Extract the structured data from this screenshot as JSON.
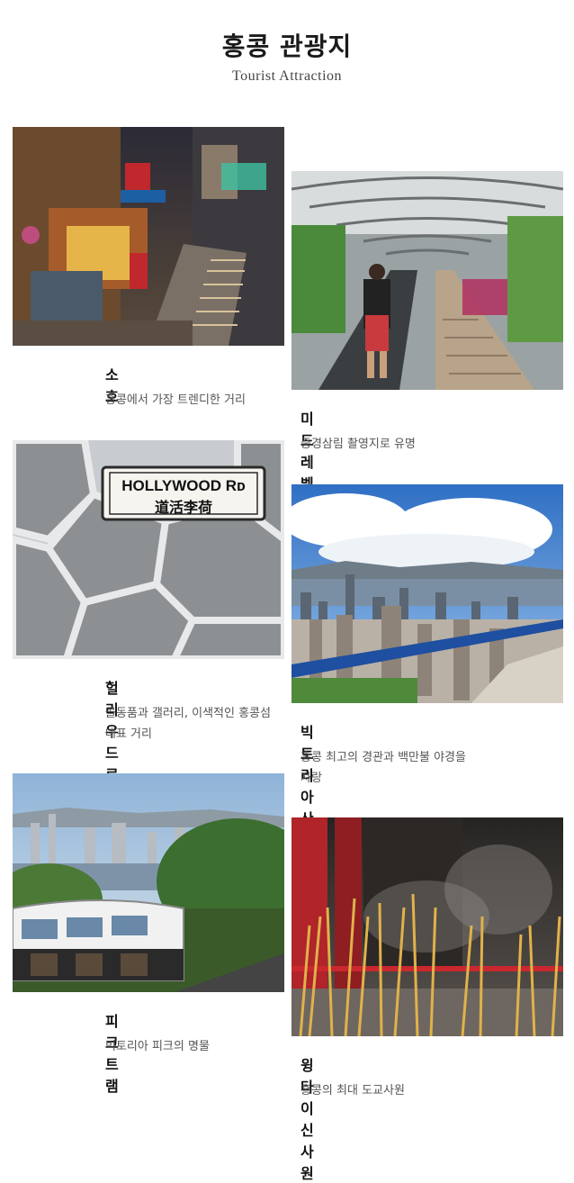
{
  "header": {
    "title": "홍콩 관광지",
    "subtitle": "Tourist Attraction"
  },
  "attractions": [
    {
      "name": "소호",
      "description": "홍콩에서 가장 트렌디한 거리"
    },
    {
      "name": "미드레벨 에스컬레이터",
      "description": "중경삼림 촬영지로 유명"
    },
    {
      "name": "헐리우드 로드",
      "description": "골동품과 갤러리, 이색적인 홍콩섬 대표 거리",
      "sign_text_en": "HOLLYWOOD Rᴅ",
      "sign_text_cn": "道活李荷"
    },
    {
      "name": "빅토리아 산정",
      "description": "홍콩 최고의 경관과 백만불 야경을 자랑"
    },
    {
      "name": "피크트램",
      "description": "빅토리아 피크의 명물"
    },
    {
      "name": "윙타이신 사원",
      "description": "홍콩의 최대 도교사원"
    }
  ]
}
